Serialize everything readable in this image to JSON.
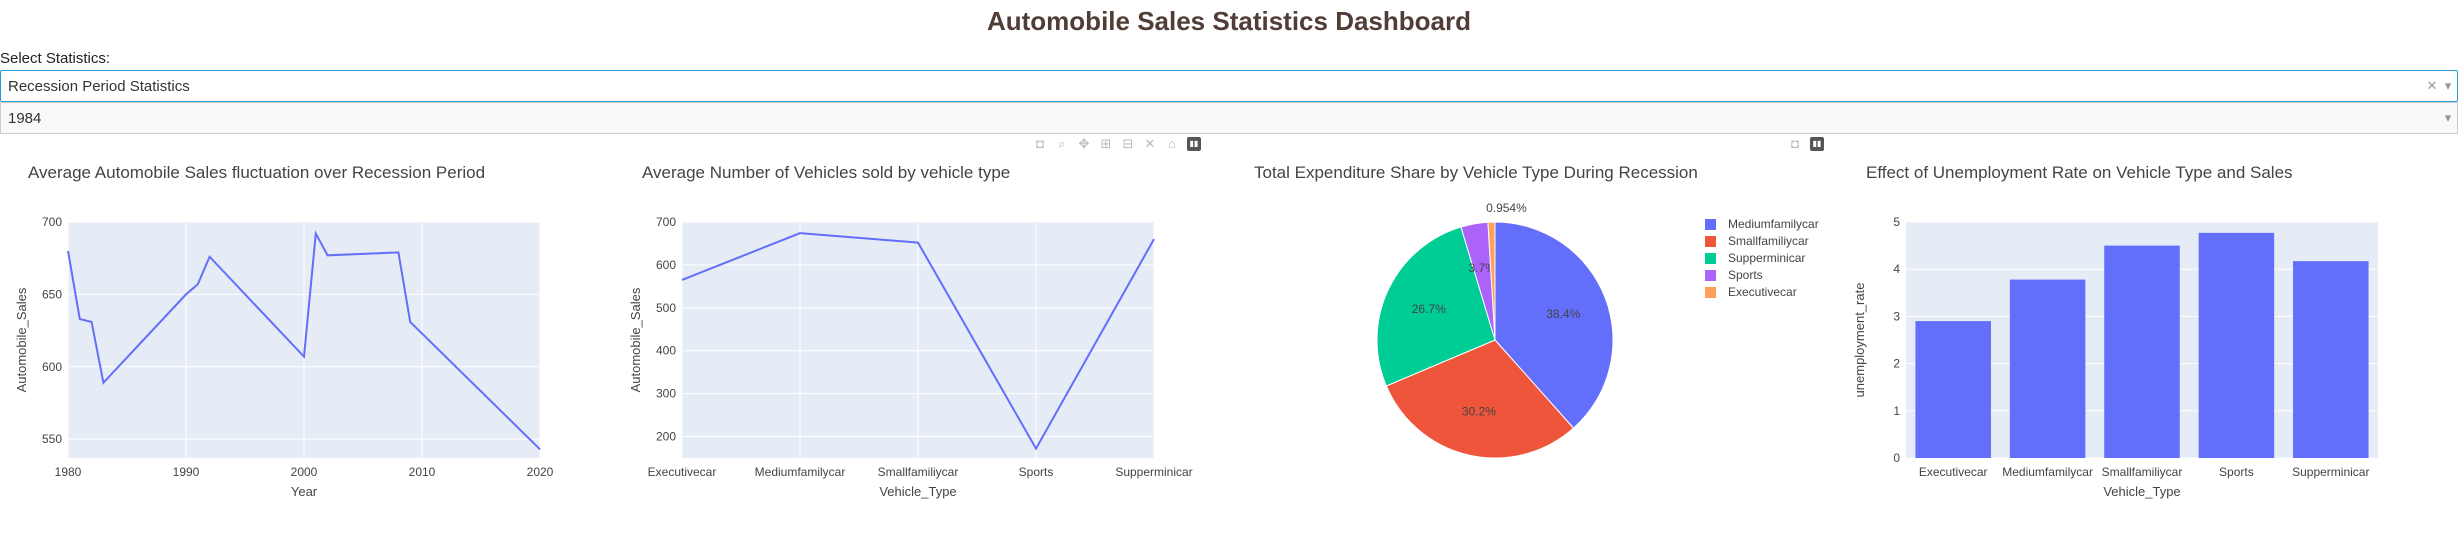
{
  "header": {
    "title": "Automobile Sales Statistics Dashboard"
  },
  "controls": {
    "select_label": "Select Statistics:",
    "statistics_value": "Recession Period Statistics",
    "year_value": "1984",
    "clear_icon": "close-icon",
    "arrow_icon": "chevron-down-icon"
  },
  "colors": {
    "line": "#636efa",
    "plot_bg": "#e5ecf6",
    "title": "#503D36",
    "pie": [
      "#636efa",
      "#ef553b",
      "#00cc96",
      "#ab63fa",
      "#ffa15a"
    ]
  },
  "modebar_icons": [
    "camera-icon",
    "zoom-icon",
    "pan-icon",
    "zoom-in-icon",
    "zoom-out-icon",
    "autoscale-icon",
    "reset-axes-icon",
    "plotly-logo-icon"
  ],
  "chart_data": [
    {
      "type": "line",
      "title": "Average Automobile Sales fluctuation over Recession Period",
      "xlabel": "Year",
      "ylabel": "Automobile_Sales",
      "xlim": [
        1980,
        2020
      ],
      "ylim": [
        537,
        700
      ],
      "xticks": [
        "1980",
        "1990",
        "2000",
        "2010",
        "2020"
      ],
      "yticks": [
        "550",
        "600",
        "650",
        "700"
      ],
      "x": [
        1980,
        1981,
        1982,
        1983,
        1990,
        1991,
        1992,
        2000,
        2001,
        2002,
        2008,
        2009,
        2020
      ],
      "y": [
        680,
        633,
        631,
        589,
        650,
        657,
        676,
        607,
        692,
        677,
        679,
        631,
        543
      ]
    },
    {
      "type": "line",
      "title": "Average Number of Vehicles sold by vehicle type",
      "xlabel": "Vehicle_Type",
      "ylabel": "Automobile_Sales",
      "categories": [
        "Executivecar",
        "Mediumfamilycar",
        "Smallfamiliycar",
        "Sports",
        "Supperminicar"
      ],
      "values": [
        565,
        674,
        652,
        172,
        660
      ],
      "ylim": [
        150,
        700
      ],
      "yticks": [
        "200",
        "300",
        "400",
        "500",
        "600",
        "700"
      ]
    },
    {
      "type": "pie",
      "title": "Total Expenditure Share by Vehicle Type During Recession",
      "labels": [
        "Mediumfamilycar",
        "Smallfamiliycar",
        "Supperminicar",
        "Sports",
        "Executivecar"
      ],
      "values": [
        38.4,
        30.2,
        26.7,
        3.7,
        0.954
      ],
      "text_labels": [
        "38.4%",
        "30.2%",
        "26.7%",
        "3.7%",
        "0.954%"
      ],
      "legend": "right"
    },
    {
      "type": "bar",
      "title": "Effect of Unemployment Rate on Vehicle Type and Sales",
      "xlabel": "Vehicle_Type",
      "ylabel": "unemployment_rate",
      "categories": [
        "Executivecar",
        "Mediumfamilycar",
        "Smallfamiliycar",
        "Sports",
        "Supperminicar"
      ],
      "values": [
        2.9,
        3.78,
        4.5,
        4.77,
        4.17
      ],
      "ylim": [
        0,
        5
      ],
      "yticks": [
        "0",
        "1",
        "2",
        "3",
        "4",
        "5"
      ]
    }
  ]
}
